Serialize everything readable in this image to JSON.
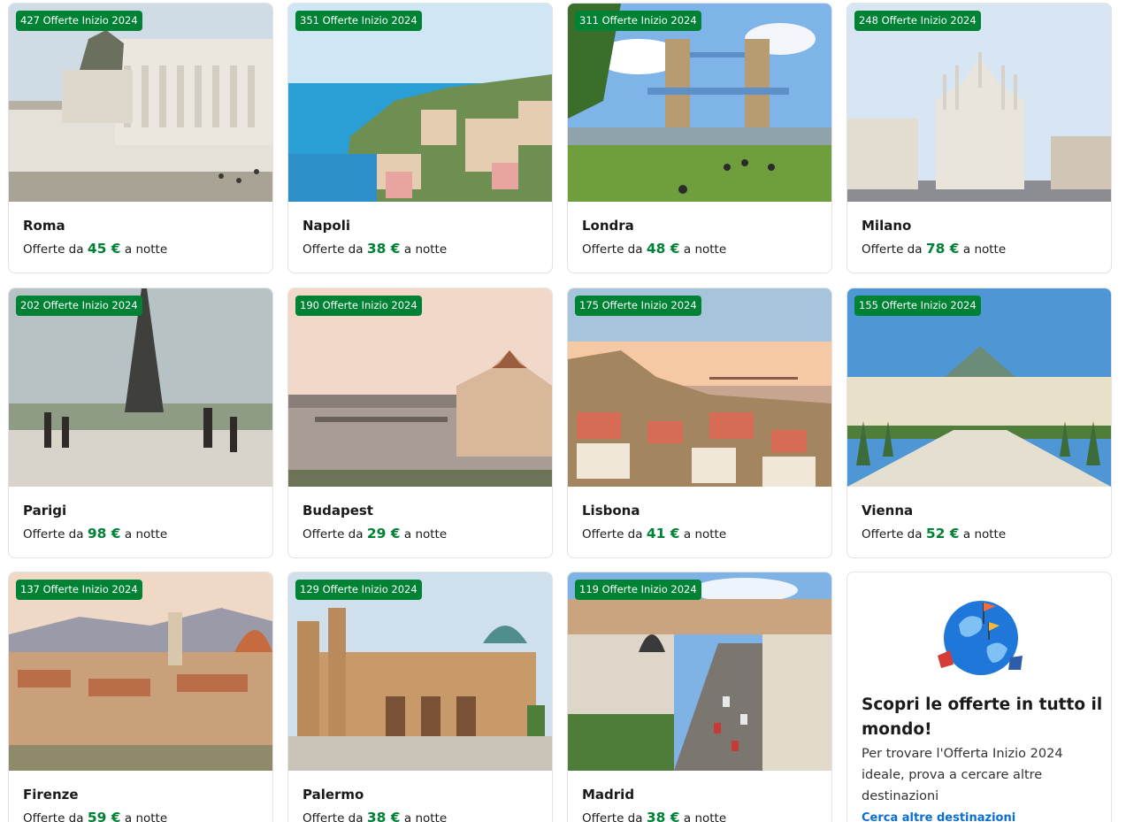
{
  "offers": [
    {
      "badge": "427 Offerte Inizio 2024",
      "city": "Roma",
      "price_prefix": "Offerte da",
      "price": "45 €",
      "price_suffix": "a notte"
    },
    {
      "badge": "351 Offerte Inizio 2024",
      "city": "Napoli",
      "price_prefix": "Offerte da",
      "price": "38 €",
      "price_suffix": "a notte"
    },
    {
      "badge": "311 Offerte Inizio 2024",
      "city": "Londra",
      "price_prefix": "Offerte da",
      "price": "48 €",
      "price_suffix": "a notte"
    },
    {
      "badge": "248 Offerte Inizio 2024",
      "city": "Milano",
      "price_prefix": "Offerte da",
      "price": "78 €",
      "price_suffix": "a notte"
    },
    {
      "badge": "202 Offerte Inizio 2024",
      "city": "Parigi",
      "price_prefix": "Offerte da",
      "price": "98 €",
      "price_suffix": "a notte"
    },
    {
      "badge": "190 Offerte Inizio 2024",
      "city": "Budapest",
      "price_prefix": "Offerte da",
      "price": "29 €",
      "price_suffix": "a notte"
    },
    {
      "badge": "175 Offerte Inizio 2024",
      "city": "Lisbona",
      "price_prefix": "Offerte da",
      "price": "41 €",
      "price_suffix": "a notte"
    },
    {
      "badge": "155 Offerte Inizio 2024",
      "city": "Vienna",
      "price_prefix": "Offerte da",
      "price": "52 €",
      "price_suffix": "a notte"
    },
    {
      "badge": "137 Offerte Inizio 2024",
      "city": "Firenze",
      "price_prefix": "Offerte da",
      "price": "59 €",
      "price_suffix": "a notte"
    },
    {
      "badge": "129 Offerte Inizio 2024",
      "city": "Palermo",
      "price_prefix": "Offerte da",
      "price": "38 €",
      "price_suffix": "a notte"
    },
    {
      "badge": "119 Offerte Inizio 2024",
      "city": "Madrid",
      "price_prefix": "Offerte da",
      "price": "38 €",
      "price_suffix": "a notte"
    }
  ],
  "promo": {
    "title": "Scopri le offerte in tutto il mondo!",
    "text": "Per trovare l'Offerta Inizio 2024 ideale, prova a cercare altre destinazioni",
    "link": "Cerca altre destinazioni"
  },
  "colors": {
    "badge_bg": "#008234",
    "price": "#008234",
    "link": "#0a6ed1",
    "card_border": "#e2e2e2"
  },
  "icons": {
    "promo_illustration": "globe-with-flags-icon"
  }
}
